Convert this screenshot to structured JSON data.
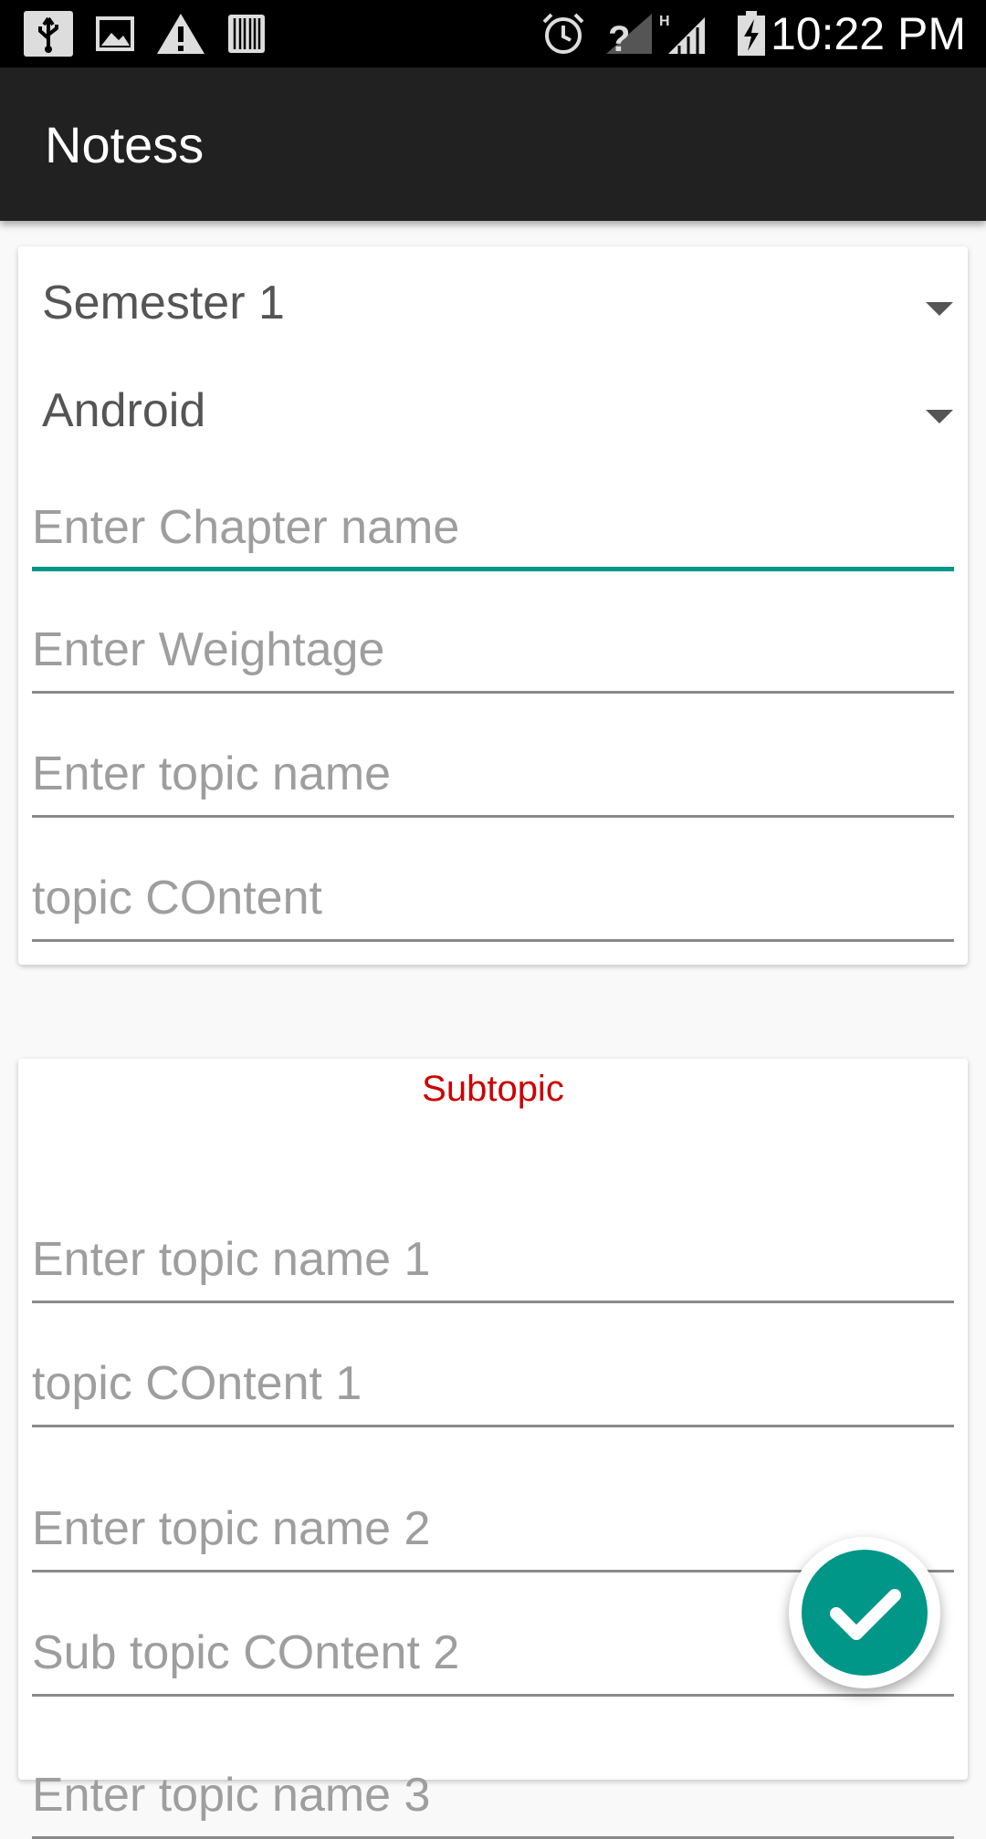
{
  "status_bar": {
    "time": "10:22 PM",
    "icons": [
      "usb-icon",
      "image-icon",
      "warning-icon",
      "barcode-icon",
      "alarm-icon",
      "no-sim-icon",
      "signal-icon",
      "battery-icon"
    ]
  },
  "app_bar": {
    "title": "Notess"
  },
  "form": {
    "semester_value": "Semester 1",
    "subject_value": "Android",
    "chapter_placeholder": "Enter Chapter name",
    "weightage_placeholder": "Enter Weightage",
    "topic_name_placeholder": "Enter topic name",
    "topic_content_placeholder": "topic COntent"
  },
  "subtopic": {
    "title": "Subtopic",
    "fields": [
      {
        "placeholder": "Enter topic name 1"
      },
      {
        "placeholder": "topic COntent 1"
      },
      {
        "placeholder": "Enter topic name 2"
      },
      {
        "placeholder": "Sub topic COntent 2"
      },
      {
        "placeholder": "Enter topic name 3"
      }
    ]
  },
  "colors": {
    "accent": "#009688",
    "subtopic_title": "#cc0000",
    "app_bar": "#212121"
  }
}
